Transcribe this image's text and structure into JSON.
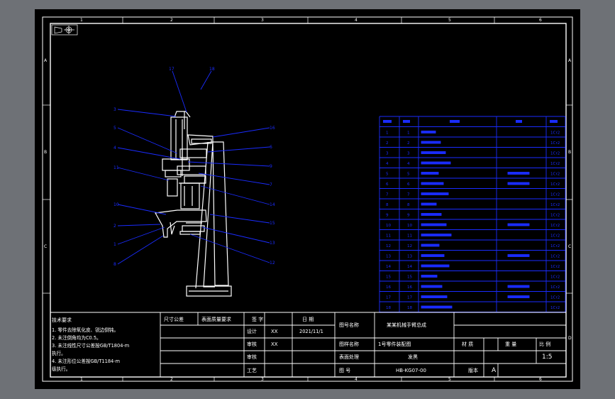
{
  "zones_top": [
    "1",
    "2",
    "3",
    "4",
    "5",
    "6"
  ],
  "zones_bottom": [
    "1",
    "2",
    "3",
    "4",
    "5",
    "6"
  ],
  "zones_left": [
    "A",
    "B",
    "C"
  ],
  "zones_right": [
    "A",
    "B",
    "C",
    "D"
  ],
  "balloons_left": [
    "3",
    "5",
    "4",
    "11",
    "10",
    "2",
    "1",
    "8"
  ],
  "balloons_right": [
    "16",
    "6",
    "9",
    "7",
    "14",
    "15",
    "13",
    "12"
  ],
  "balloons_top": [
    "17",
    "18"
  ],
  "bom": {
    "rows": [
      {
        "no": "1",
        "code": "1",
        "mat": "1Cr2"
      },
      {
        "no": "2",
        "code": "2",
        "mat": "1Cr2"
      },
      {
        "no": "3",
        "code": "3",
        "mat": "1Cr2"
      },
      {
        "no": "4",
        "code": "4",
        "mat": "1Cr2"
      },
      {
        "no": "5",
        "code": "5",
        "mat": "1Cr2"
      },
      {
        "no": "6",
        "code": "6",
        "mat": "1Cr2"
      },
      {
        "no": "7",
        "code": "7",
        "mat": "1Cr2"
      },
      {
        "no": "8",
        "code": "8",
        "mat": "1Cr2"
      },
      {
        "no": "9",
        "code": "9",
        "mat": "1Cr2"
      },
      {
        "no": "10",
        "code": "10",
        "mat": "1Cr2"
      },
      {
        "no": "11",
        "code": "11",
        "mat": "1Cr2"
      },
      {
        "no": "12",
        "code": "12",
        "mat": "1Cr2"
      },
      {
        "no": "13",
        "code": "13",
        "mat": "1Cr2"
      },
      {
        "no": "14",
        "code": "14",
        "mat": "1Cr2"
      },
      {
        "no": "15",
        "code": "15",
        "mat": "1Cr2"
      },
      {
        "no": "16",
        "code": "16",
        "mat": "1Cr2"
      },
      {
        "no": "17",
        "code": "17",
        "mat": "1Cr2"
      },
      {
        "no": "18",
        "code": "18",
        "mat": "1Cr2"
      }
    ]
  },
  "notes": {
    "title": "技术要求",
    "lines": [
      "1. 零件去除氧化皮、锐边倒钝。",
      "2. 未注倒角均为C0.5。",
      "3. 未注线性尺寸公差按GB/T1804-m",
      "   执行。",
      "4. 未注形位公差按GB/T1184-m",
      "   级执行。"
    ]
  },
  "title_block": {
    "tol_label": "尺寸公差",
    "surface_label": "表面质量要求",
    "sign_label": "签 字",
    "date_label": "日 期",
    "design_label": "设计",
    "designer": "XX",
    "design_date": "2021/11/1",
    "check_label": "审核",
    "checker": "XX",
    "approve_label": "审核",
    "process_label": "工艺",
    "drawing_name_label": "图号名称",
    "drawing_name": "某某机械手臂总成",
    "material_label": "图样名称",
    "material": "1号零件装配图",
    "heat_label": "表面处理",
    "heat_value": "发黑",
    "qty_label": "材 质",
    "weight_label": "重 量",
    "scale_label": "比 例",
    "scale": "1:5",
    "drawing_no_label": "图 号",
    "drawing_no": "HB-KG07-00",
    "sheet_label": "版本",
    "sheet": "A"
  }
}
